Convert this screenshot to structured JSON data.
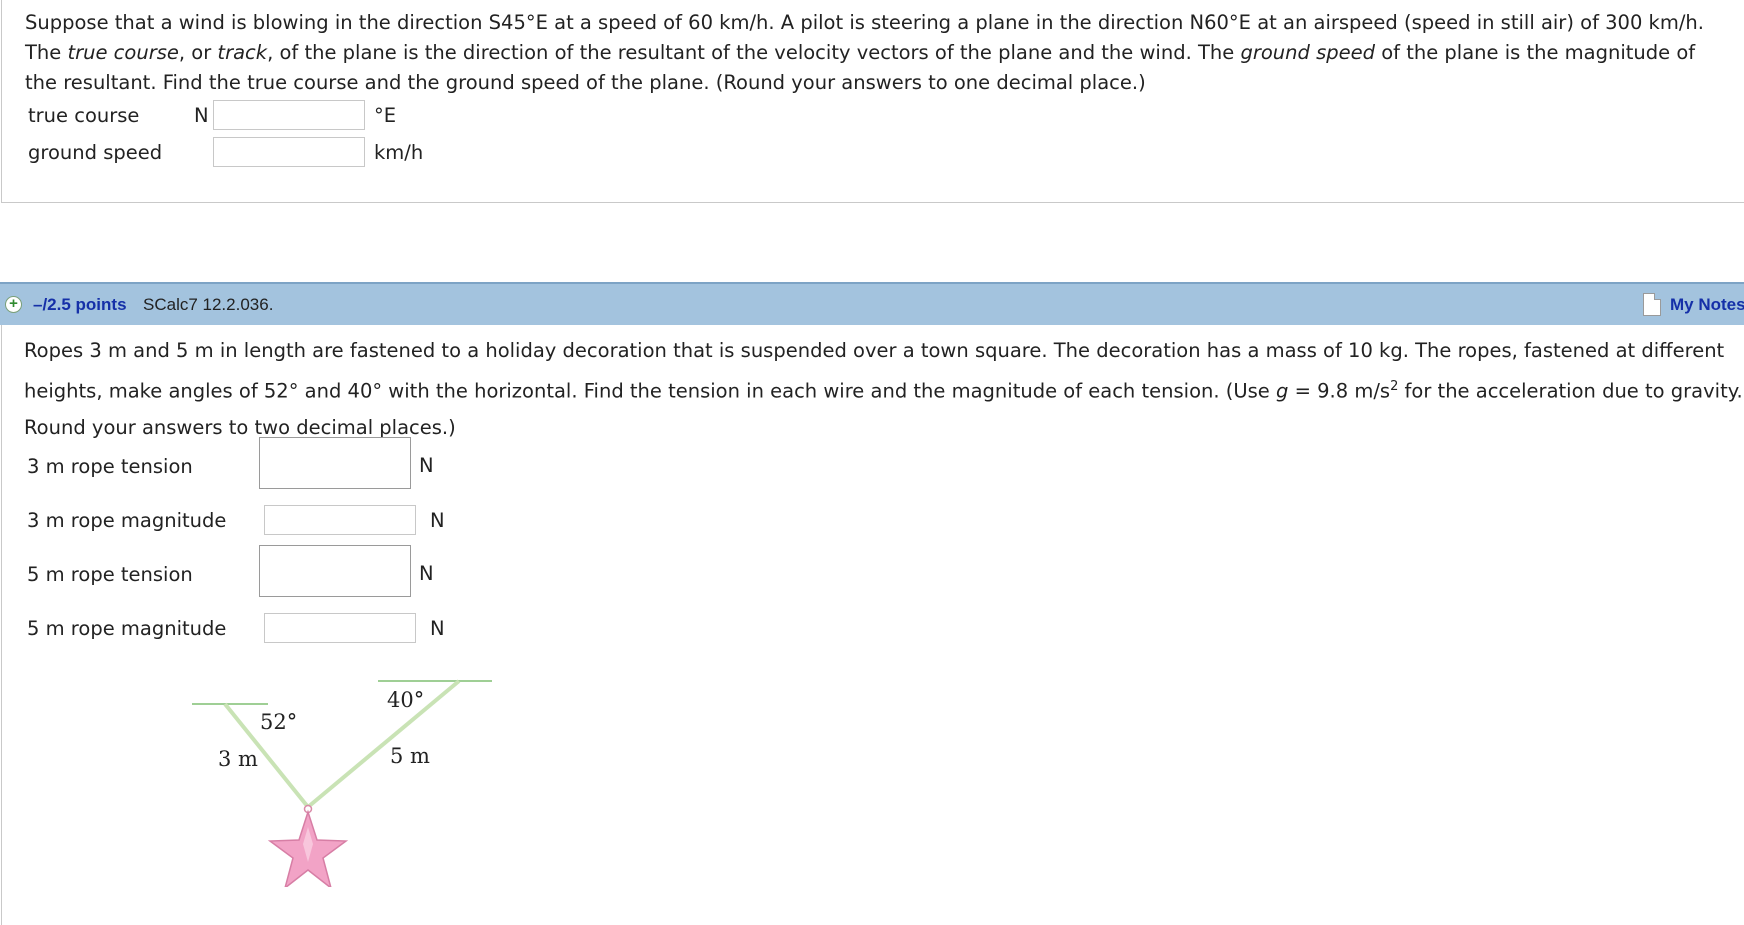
{
  "question1": {
    "text_part1": "Suppose that a wind is blowing in the direction S45°E at a speed of 60 km/h. A pilot is steering a plane in the direction N60°E at an airspeed (speed in still air) of 300 km/h. The ",
    "term_true_course": "true course",
    "text_part2": ", or ",
    "term_track": "track",
    "text_part3": ", of the plane is the direction of the resultant of the velocity vectors of the plane and the wind. The ",
    "term_ground_speed": "ground speed",
    "text_part4": " of the plane is the magnitude of the resultant. Find the true course and the ground speed of the plane. (Round your answers to one decimal place.)",
    "true_course_label": "true course",
    "true_course_prefix": "N",
    "true_course_value": "",
    "true_course_unit": "°E",
    "ground_speed_label": "ground speed",
    "ground_speed_value": "",
    "ground_speed_unit": "km/h"
  },
  "question2": {
    "header": {
      "points": "–/2.5 points",
      "source": "SCalc7 12.2.036.",
      "my_notes": "My Notes"
    },
    "text_part1": "Ropes 3 m and 5 m in length are fastened to a holiday decoration that is suspended over a town square. The decoration has a mass of 10 kg. The ropes, fastened at different heights, make angles of 52° and 40° with the horizontal. Find the tension in each wire and the magnitude of each tension. (Use ",
    "g_symbol": "g",
    "text_part2": " = 9.8 m/s",
    "superscript": "2",
    "text_part3": " for the acceleration due to gravity. Round your answers to two decimal places.)",
    "fields": [
      {
        "label": "3 m rope tension",
        "unit": "N",
        "value": ""
      },
      {
        "label": "3 m rope magnitude",
        "unit": "N",
        "value": ""
      },
      {
        "label": "5 m rope tension",
        "unit": "N",
        "value": ""
      },
      {
        "label": "5 m rope magnitude",
        "unit": "N",
        "value": ""
      }
    ],
    "figure": {
      "angle_left": "52°",
      "angle_right": "40°",
      "length_left": "3 m",
      "length_right": "5 m"
    }
  },
  "colors": {
    "header_bg": "#a3c3de",
    "link_blue": "#1530a8",
    "star_pink": "#f2a3c6",
    "rope_green": "#c9e3b5"
  }
}
